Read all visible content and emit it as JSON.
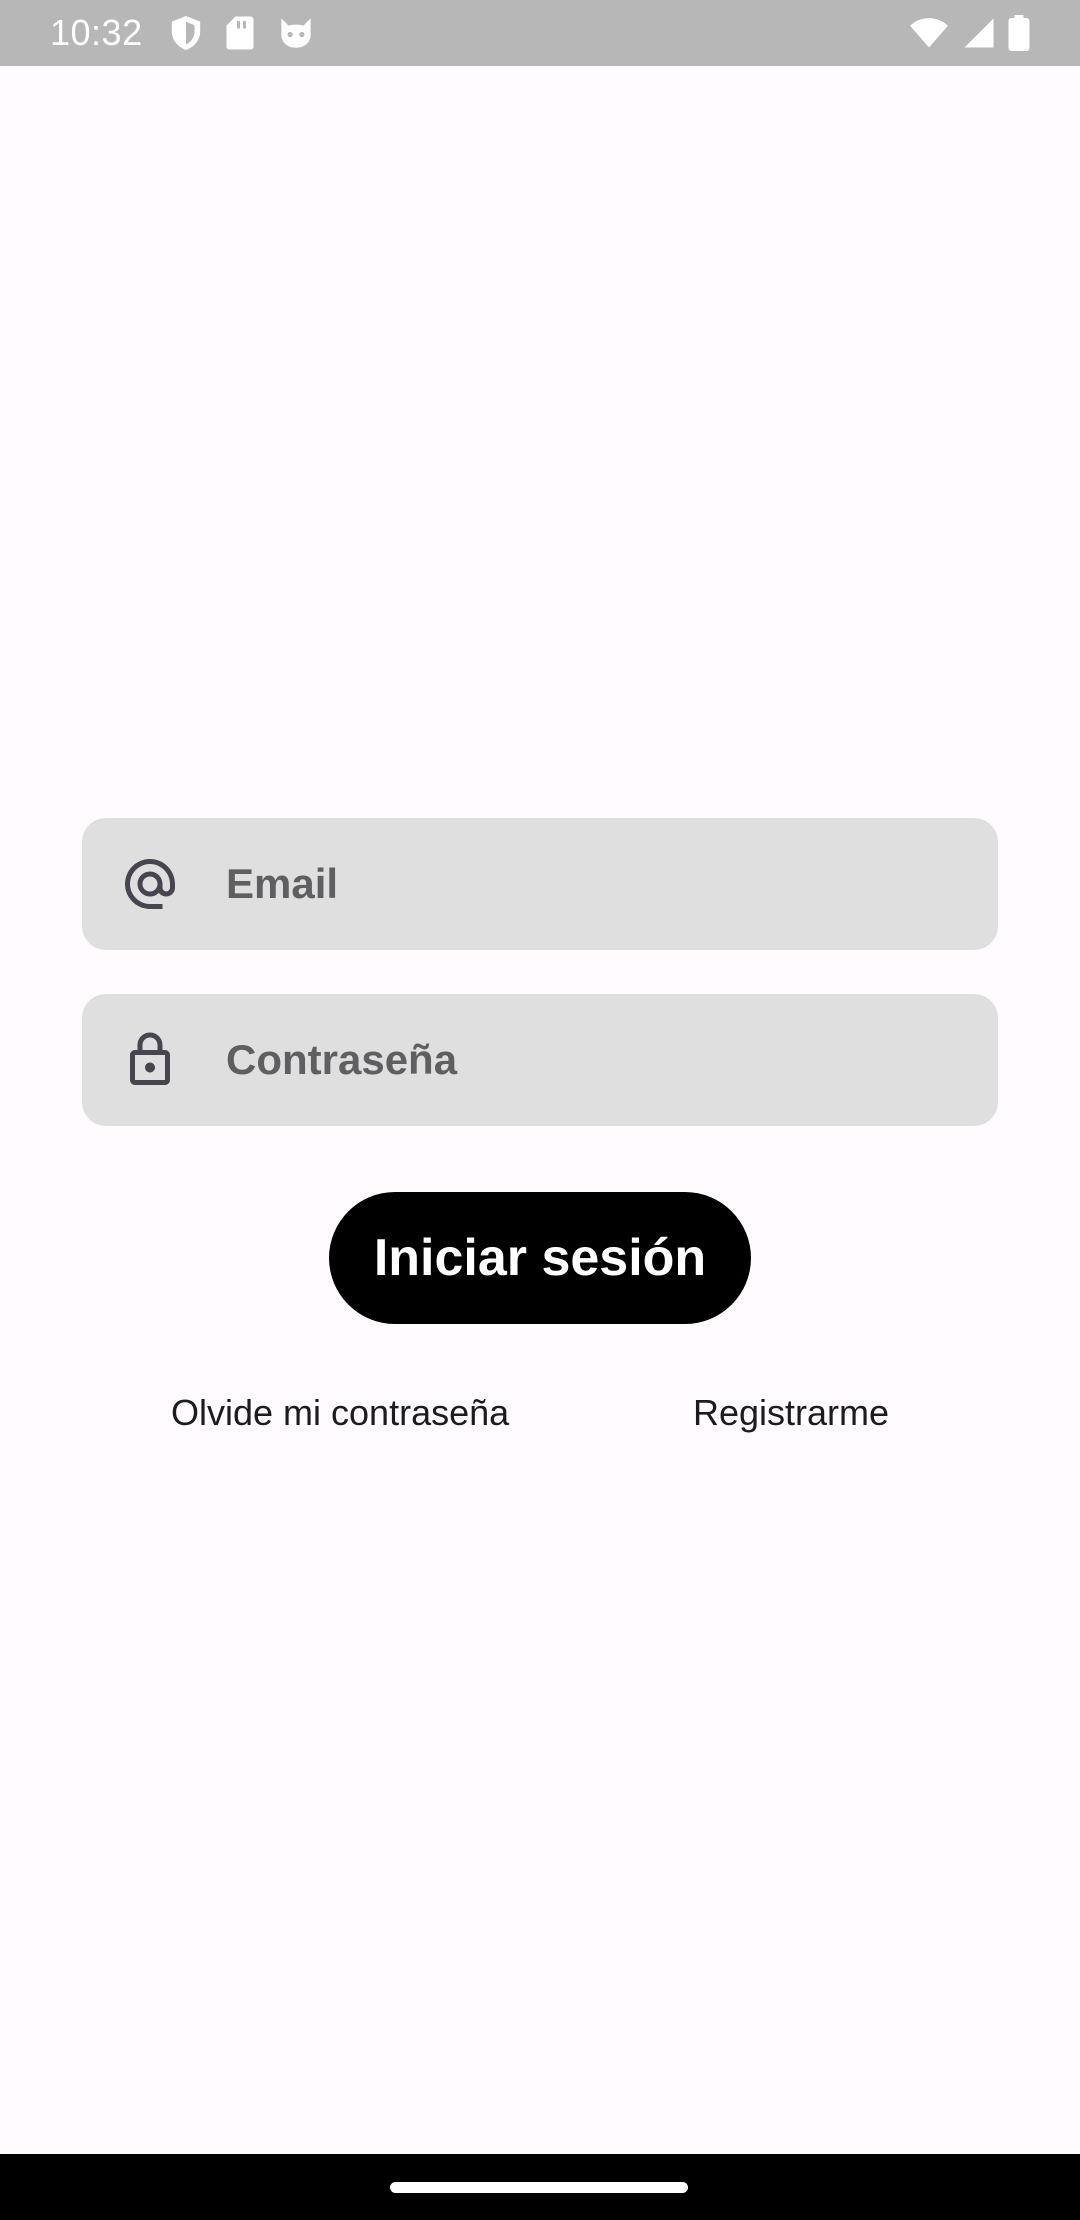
{
  "status_bar": {
    "time": "10:32",
    "left_icons": [
      "shield-icon",
      "sd-card-icon",
      "cat-face-icon"
    ],
    "right_icons": [
      "wifi-icon",
      "signal-icon",
      "battery-icon"
    ]
  },
  "login_form": {
    "email": {
      "placeholder": "Email",
      "value": "",
      "icon": "at-sign-icon"
    },
    "password": {
      "placeholder": "Contraseña",
      "value": "",
      "icon": "lock-icon"
    },
    "submit_label": "Iniciar sesión"
  },
  "links": {
    "forgot_password": "Olvide mi contraseña",
    "register": "Registrarme"
  },
  "colors": {
    "background": "#fffbfe",
    "status_bar": "#b8b7b8",
    "field_background": "#e0dfe0",
    "button_background": "#000000",
    "button_text": "#ffffff",
    "nav_bar": "#000000"
  }
}
